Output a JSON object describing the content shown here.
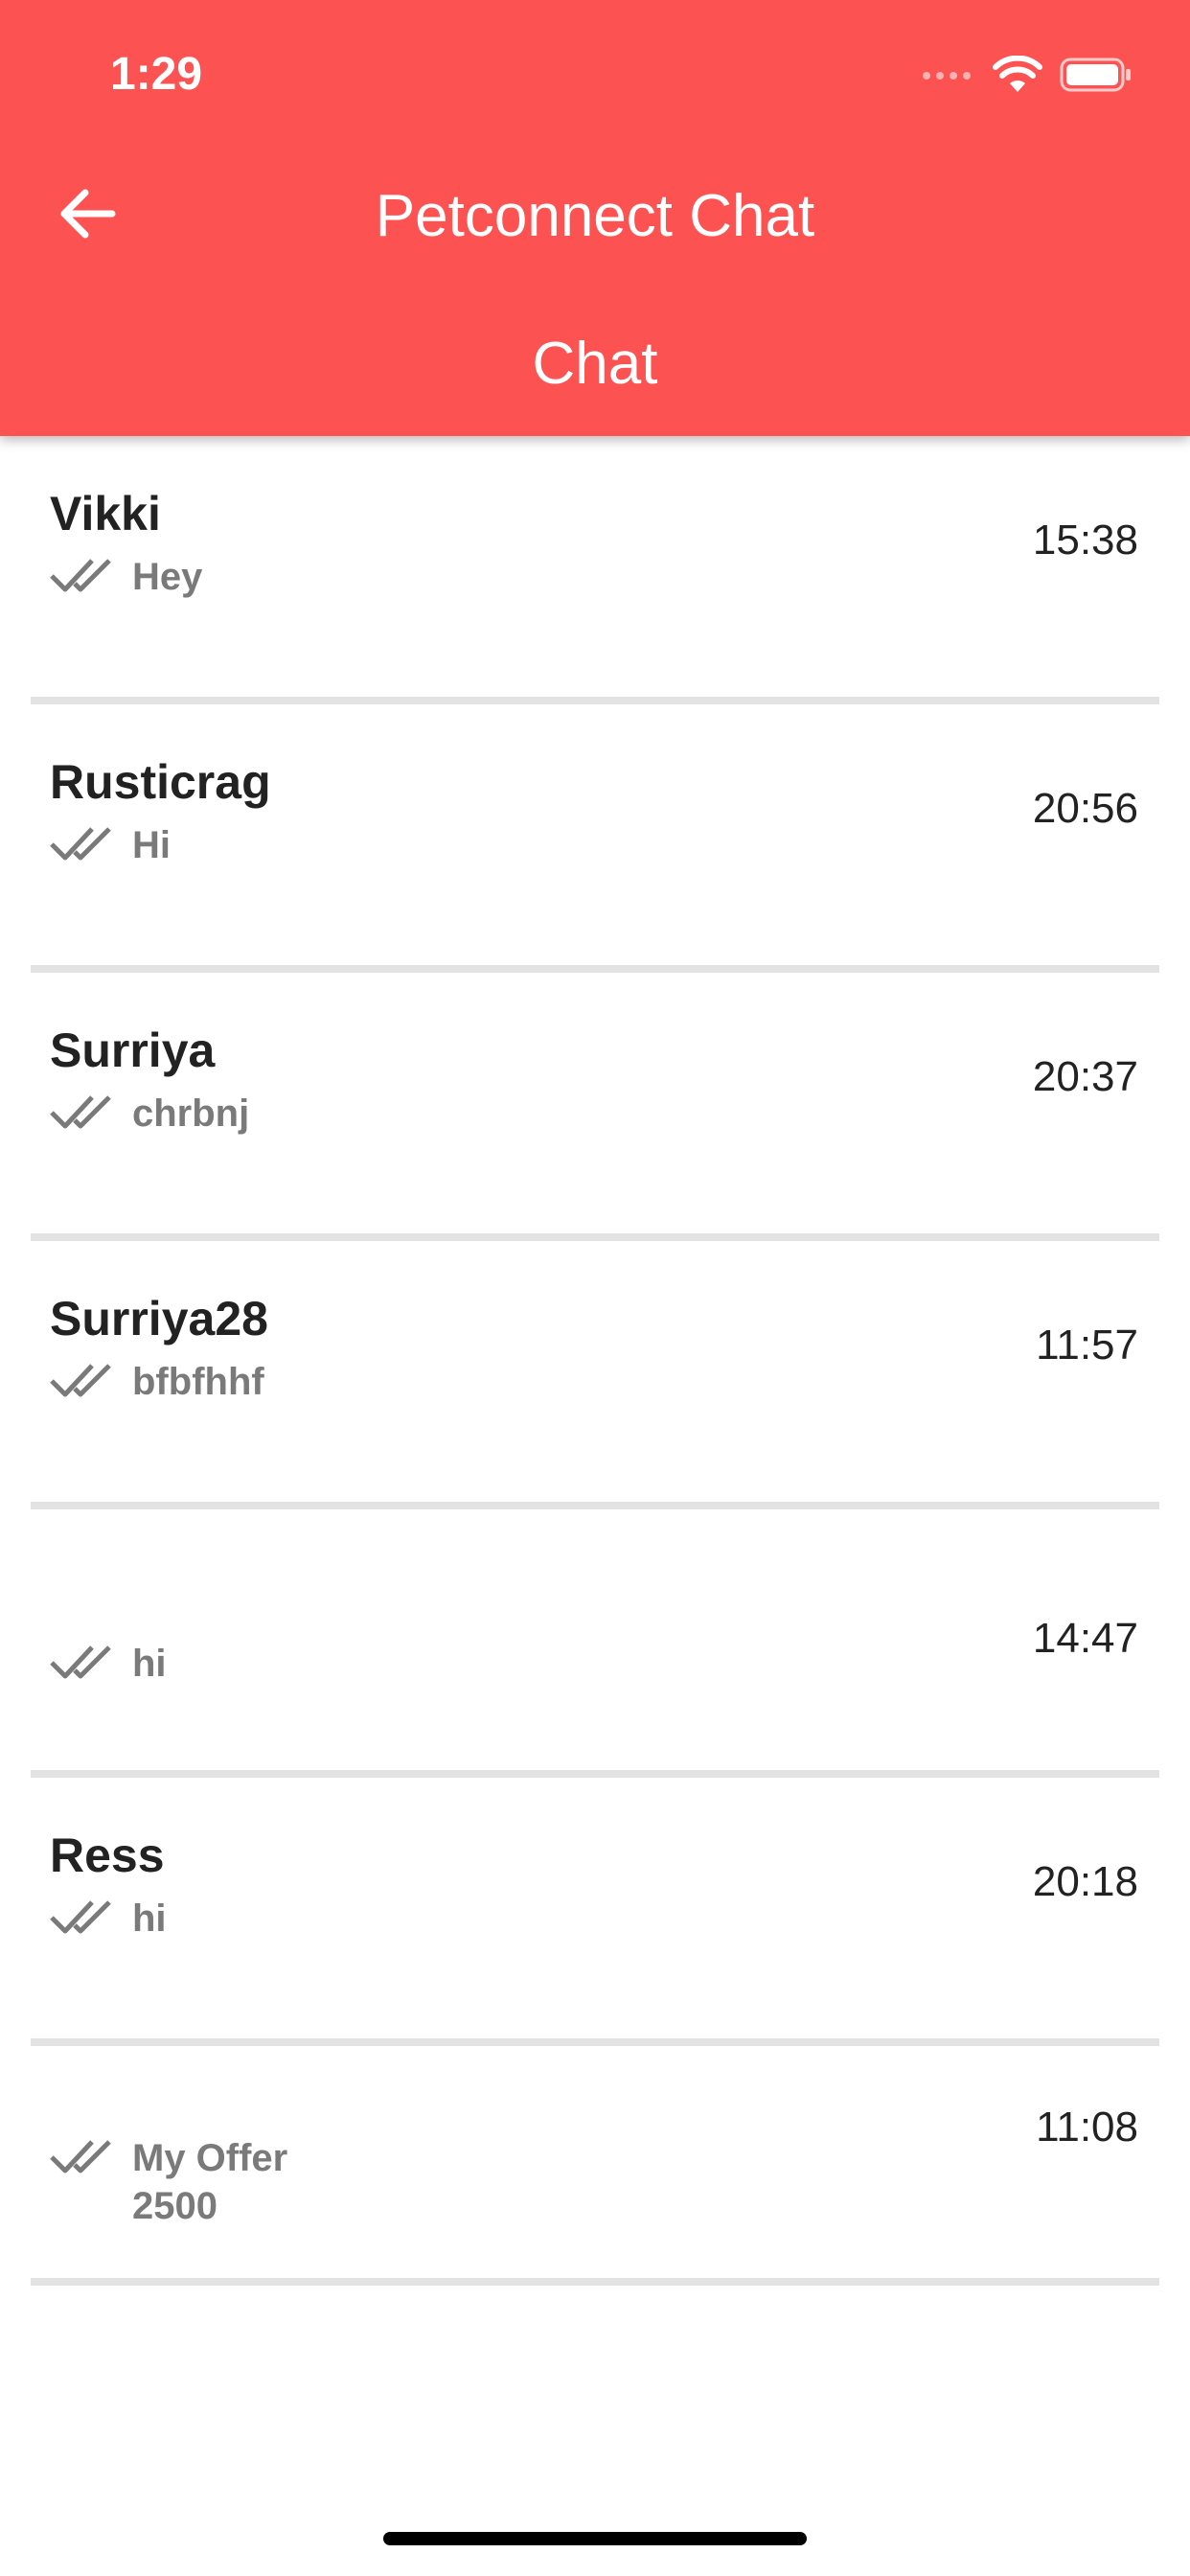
{
  "status_bar": {
    "time": "1:29"
  },
  "header": {
    "title": "Petconnect Chat",
    "subtitle": "Chat"
  },
  "chats": [
    {
      "name": "Vikki",
      "message": "Hey",
      "time": "15:38"
    },
    {
      "name": "Rusticrag",
      "message": "Hi",
      "time": "20:56"
    },
    {
      "name": "Surriya",
      "message": "chrbnj",
      "time": "20:37"
    },
    {
      "name": "Surriya28",
      "message": "bfbfhhf",
      "time": "11:57"
    },
    {
      "name": "",
      "message": "hi",
      "time": "14:47"
    },
    {
      "name": "Ress",
      "message": "hi",
      "time": "20:18"
    },
    {
      "name": "",
      "message": "My Offer\n2500",
      "time": "11:08"
    }
  ],
  "colors": {
    "header_bg": "#fd5252",
    "divider": "#e2e2e2",
    "name_text": "#222222",
    "preview_text": "#7a7a7a"
  },
  "icons": {
    "back": "arrow-left-icon",
    "read_status": "double-check-icon",
    "signal": "signal-icon",
    "wifi": "wifi-icon",
    "battery": "battery-icon"
  }
}
